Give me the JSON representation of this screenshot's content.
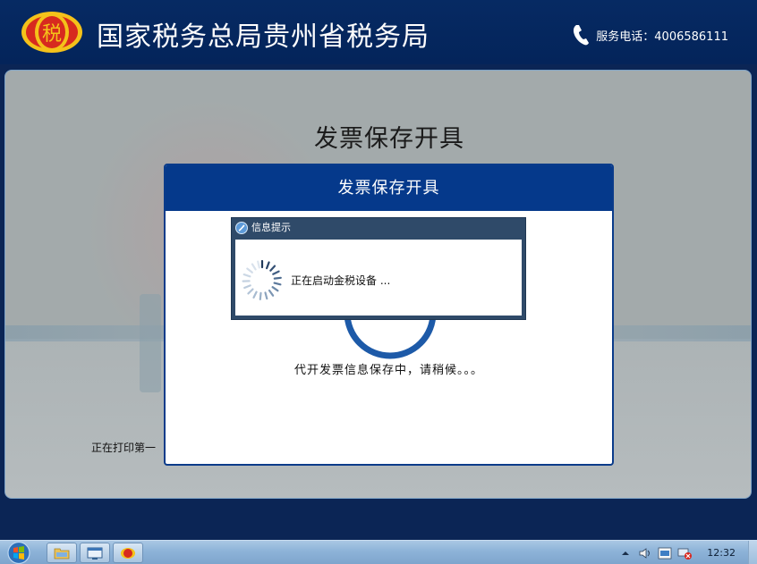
{
  "header": {
    "title": "国家税务总局贵州省税务局",
    "emblem_label": "税",
    "phone_label": "服务电话：4006586111"
  },
  "main": {
    "page_title": "发票保存开具",
    "printing_status": "正在打印第一"
  },
  "dialog": {
    "title": "发票保存开具",
    "message": "代开发票信息保存中，请稍候。。。"
  },
  "popup": {
    "title": "信息提示",
    "message": "正在启动金税设备 ..."
  },
  "taskbar": {
    "clock": "12:32"
  },
  "colors": {
    "header_bg": "#062a63",
    "dialog_header": "#05398b",
    "popup_frame": "#2f4a69",
    "emblem_red": "#d72a1f",
    "emblem_gold": "#f4c21a"
  }
}
